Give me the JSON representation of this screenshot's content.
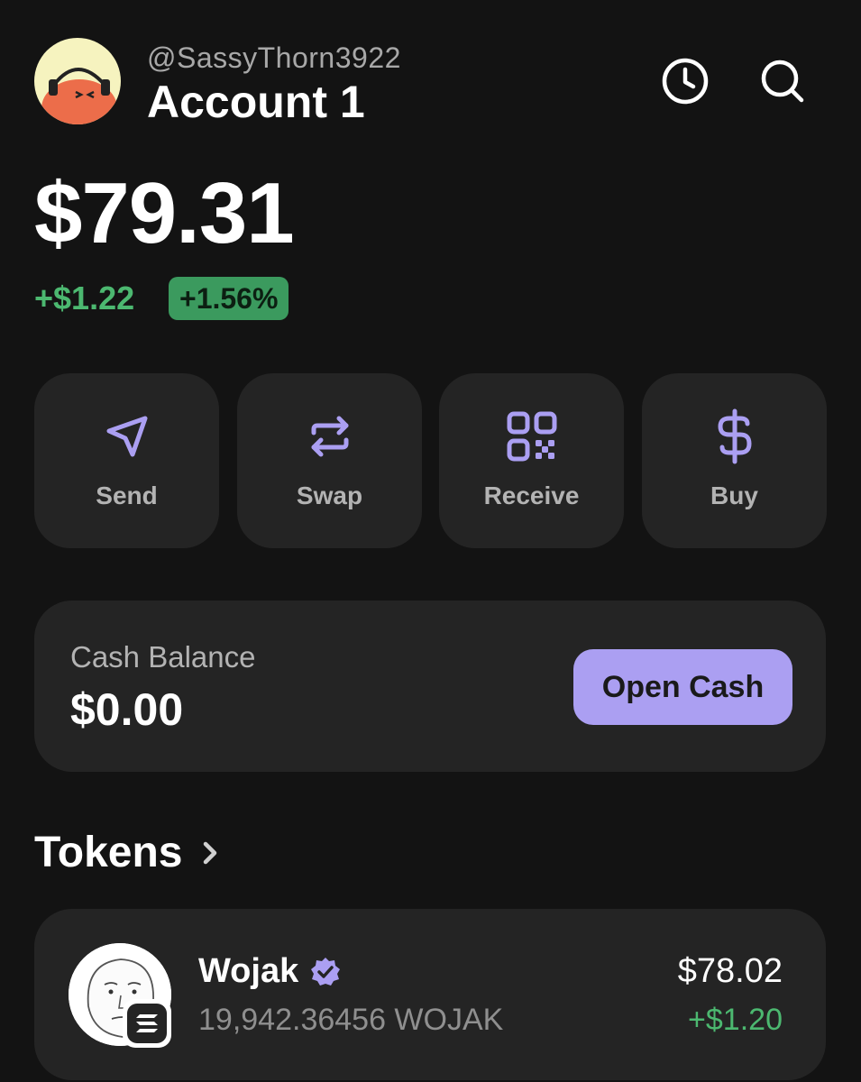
{
  "header": {
    "handle": "@SassyThorn3922",
    "account_name": "Account 1",
    "icons": [
      "history-icon",
      "search-icon"
    ]
  },
  "balance": {
    "total": "$79.31",
    "change_abs": "+$1.22",
    "change_pct": "+1.56%"
  },
  "actions": [
    {
      "label": "Send",
      "icon": "send-icon"
    },
    {
      "label": "Swap",
      "icon": "swap-icon"
    },
    {
      "label": "Receive",
      "icon": "qr-code-icon"
    },
    {
      "label": "Buy",
      "icon": "dollar-icon"
    }
  ],
  "cash": {
    "label": "Cash Balance",
    "value": "$0.00",
    "button": "Open Cash"
  },
  "tokens": {
    "title": "Tokens",
    "items": [
      {
        "name": "Wojak",
        "verified": true,
        "amount": "19,942.36456 WOJAK",
        "value": "$78.02",
        "change": "+$1.20"
      }
    ]
  },
  "colors": {
    "background": "#131313",
    "card": "#242424",
    "accent": "#ab9ff2",
    "positive": "#4cb870"
  }
}
